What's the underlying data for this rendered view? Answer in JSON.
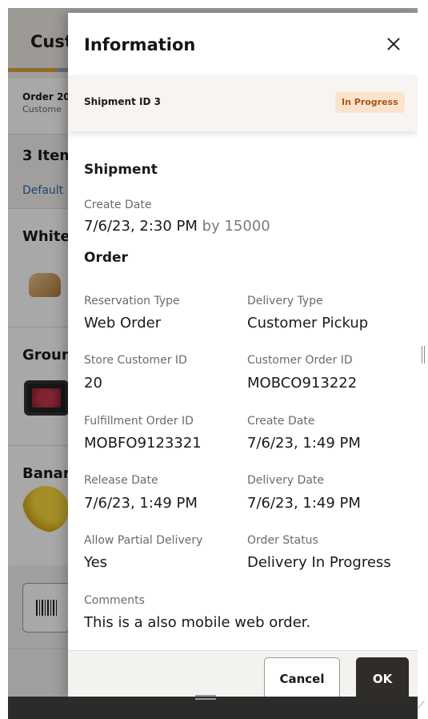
{
  "background": {
    "header_title": "Cust",
    "order_title": "Order 20",
    "order_sub": "Custome",
    "items_count": "3 Item",
    "default_link": "Default",
    "rows": [
      {
        "name": "White"
      },
      {
        "name": "Groun"
      },
      {
        "name": "Banan"
      }
    ]
  },
  "dialog": {
    "title": "Information",
    "shipment_id": "Shipment ID 3",
    "status_badge": "In Progress",
    "shipment_section": "Shipment",
    "create_date_label": "Create Date",
    "create_date_value": "7/6/23, 2:30 PM",
    "create_by": "by 15000",
    "order_section": "Order",
    "fields": [
      {
        "label": "Reservation Type",
        "value": "Web Order"
      },
      {
        "label": "Delivery Type",
        "value": "Customer Pickup"
      },
      {
        "label": "Store Customer ID",
        "value": "20"
      },
      {
        "label": "Customer Order ID",
        "value": "MOBCO913222"
      },
      {
        "label": "Fulfillment Order ID",
        "value": "MOBFO9123321"
      },
      {
        "label": "Create Date",
        "value": "7/6/23, 1:49 PM"
      },
      {
        "label": "Release Date",
        "value": "7/6/23, 1:49 PM"
      },
      {
        "label": "Delivery Date",
        "value": "7/6/23, 1:49 PM"
      },
      {
        "label": "Allow Partial Delivery",
        "value": "Yes"
      },
      {
        "label": "Order Status",
        "value": "Delivery In Progress"
      }
    ],
    "comments_label": "Comments",
    "comments_value": "This is a also mobile web order.",
    "cancel_label": "Cancel",
    "ok_label": "OK"
  },
  "colors": {
    "badge_bg": "#fbe3cc",
    "badge_text": "#a8571a",
    "primary_button": "#302c29"
  },
  "icons": [
    "close-icon",
    "barcode-icon",
    "drag-handle-icon"
  ]
}
